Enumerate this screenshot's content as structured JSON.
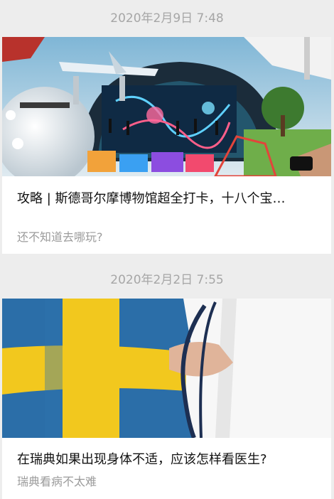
{
  "articles": [
    {
      "timestamp": "2020年2月9日 7:48",
      "title": "攻略 | 斯德哥尔摩博物馆超全打卡，十八个宝…",
      "digest": "还不知道去哪玩?",
      "cover": "museum-collage-image"
    },
    {
      "timestamp": "2020年2月2日 7:55",
      "title": "在瑞典如果出现身体不适，应该怎样看医生?",
      "digest": "瑞典看病不太难",
      "cover": "swedish-flag-doctor-image"
    }
  ],
  "colors": {
    "page_bg": "#ededed",
    "card_bg": "#ffffff",
    "timestamp": "#a6a6a6",
    "title": "#111111",
    "digest": "#9b9b9b",
    "flag_blue": "#2b6ea8",
    "flag_yellow": "#f2c81e"
  }
}
